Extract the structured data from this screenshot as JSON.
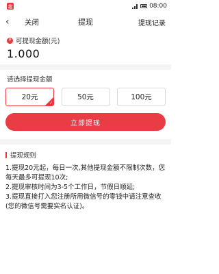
{
  "status_bar": {
    "time": "08:00",
    "app_badge": "趣"
  },
  "nav": {
    "close_label": "关闭",
    "title": "提现",
    "record_label": "提现记录"
  },
  "balance": {
    "label": "可提现金额(元)",
    "value": "1.000"
  },
  "amount": {
    "title": "请选择提现金额",
    "options": [
      {
        "label": "20元",
        "selected": true
      },
      {
        "label": "50元",
        "selected": false
      },
      {
        "label": "100元",
        "selected": false
      }
    ]
  },
  "withdraw_button": "立即提现",
  "rules": {
    "title": "提现规则",
    "items": [
      "1.提现20元起，每日一次,其他提现金额不限制次数，您每天最多可提现10次;",
      "2.提现审核时间为3-5个工作日，节假日顺延;",
      "3.提现直接打入您注册所用微信号的零钱中请注意查收(您的微信号需要实名认证)。"
    ]
  },
  "colors": {
    "accent": "#e8393f"
  }
}
